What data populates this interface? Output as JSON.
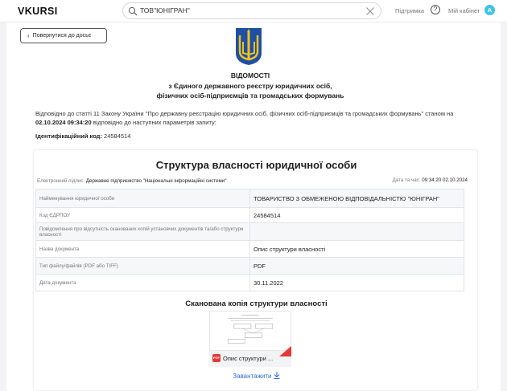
{
  "header": {
    "logo": "VKURSI",
    "search_value": "ТОВ\"ЮНІГРАН\"",
    "support_label": "Підтримка",
    "help_symbol": "?",
    "cabinet_label": "Мій кабінет",
    "avatar_letter": "A",
    "avatar_color": "#3fc4e8"
  },
  "back_button": "Повернутися до досьє",
  "title": {
    "line1": "ВІДОМОСТІ",
    "line2": "з Єдиного державного реєстру юридичних осіб,",
    "line3": "фізичних осіб-підприємців та громадських формувань"
  },
  "intro": {
    "text1": "Відповідно до статті 11 Закону України \"Про державну реєстрацію юридичних осіб, фізичних осіб-підприємців та громадських формувань\" станом на ",
    "datetime": "02.10.2024 09:34:20",
    "text2": " відповідно до наступних параметрів запиту:"
  },
  "id_code": {
    "label": "Ідентифікаційний код:",
    "value": "24584514"
  },
  "card": {
    "title": "Структура власності юридичної особи",
    "sign_label": "Електронний підпис:",
    "sign_value": "Державне підприємство \"Національні інформаційні системи\"",
    "date_label": "Дата та час:",
    "date_value": "09:34:20 02.10.2024",
    "rows": [
      {
        "key": "Найменування юридичної особи",
        "value": "ТОВАРИСТВО З ОБМЕЖЕНОЮ ВІДПОВІДАЛЬНІСТЮ \"ЮНІГРАН\""
      },
      {
        "key": "Код ЄДРПОУ",
        "value": "24584514"
      },
      {
        "key": "Повідомлення про відсутність сканованих копій установчих документів та/або структури власності",
        "value": ""
      },
      {
        "key": "Назва документа",
        "value": "Опис структури власності"
      },
      {
        "key": "Тип файлу/файлів (PDF або TIFF)",
        "value": "PDF"
      },
      {
        "key": "Дата документа",
        "value": "30.11.2022"
      }
    ],
    "scan_title": "Сканована копія структури власності",
    "file_badge": "PDF",
    "file_name": "Опис структури ...",
    "download_label": "Завантажити"
  },
  "colors": {
    "accent": "#2f6fd8",
    "pdf_red": "#e53935",
    "trident_blue": "#1f4fa3",
    "trident_gold": "#f2c21b"
  }
}
